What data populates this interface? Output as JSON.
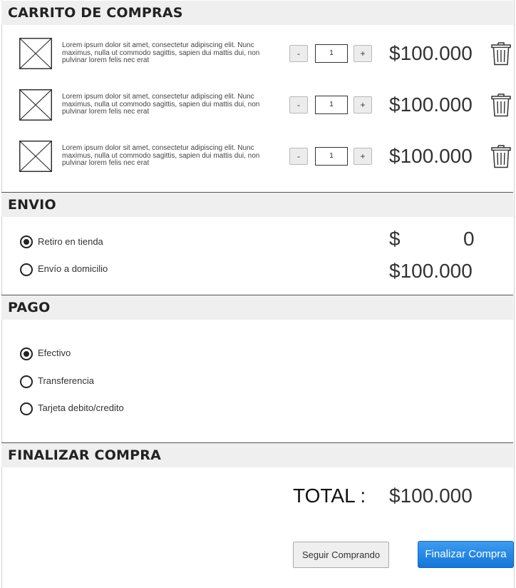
{
  "cart": {
    "title": "CARRITO DE COMPRAS",
    "items": [
      {
        "description": "Lorem ipsum dolor sit amet, consectetur adipiscing elit. Nunc maximus, nulla ut commodo sagittis, sapien dui mattis dui, non pulvinar lorem felis nec erat",
        "quantity": "1",
        "minus_label": "-",
        "plus_label": "+",
        "price": "$100.000"
      },
      {
        "description": "Lorem ipsum dolor sit amet, consectetur adipiscing elit. Nunc maximus, nulla ut commodo sagittis, sapien dui mattis dui, non pulvinar lorem felis nec erat",
        "quantity": "1",
        "minus_label": "-",
        "plus_label": "+",
        "price": "$100.000"
      },
      {
        "description": "Lorem ipsum dolor sit amet, consectetur adipiscing elit. Nunc maximus, nulla ut commodo sagittis, sapien dui mattis dui, non pulvinar lorem felis nec erat",
        "quantity": "1",
        "minus_label": "-",
        "plus_label": "+",
        "price": "$100.000"
      }
    ]
  },
  "shipping": {
    "title": "ENVIO",
    "options": [
      {
        "label": "Retiro en tienda",
        "selected": true,
        "price_symbol": "$",
        "price_amount": "0"
      },
      {
        "label": "Envío a domicilio",
        "selected": false,
        "price": "$100.000"
      }
    ]
  },
  "payment": {
    "title": "PAGO",
    "options": [
      {
        "label": "Efectivo",
        "selected": true
      },
      {
        "label": "Transferencia",
        "selected": false
      },
      {
        "label": "Tarjeta debito/credito",
        "selected": false
      }
    ]
  },
  "checkout": {
    "title": "FINALIZAR COMPRA",
    "total_label": "TOTAL :",
    "total_value": "$100.000",
    "continue_label": "Seguir Comprando",
    "finish_label": "Finalizar Compra"
  },
  "colors": {
    "primary_button": "#1a7fe0",
    "section_header_bg": "#efefef"
  },
  "icons": [
    "image-placeholder-icon",
    "trash-icon",
    "radio-icon"
  ]
}
